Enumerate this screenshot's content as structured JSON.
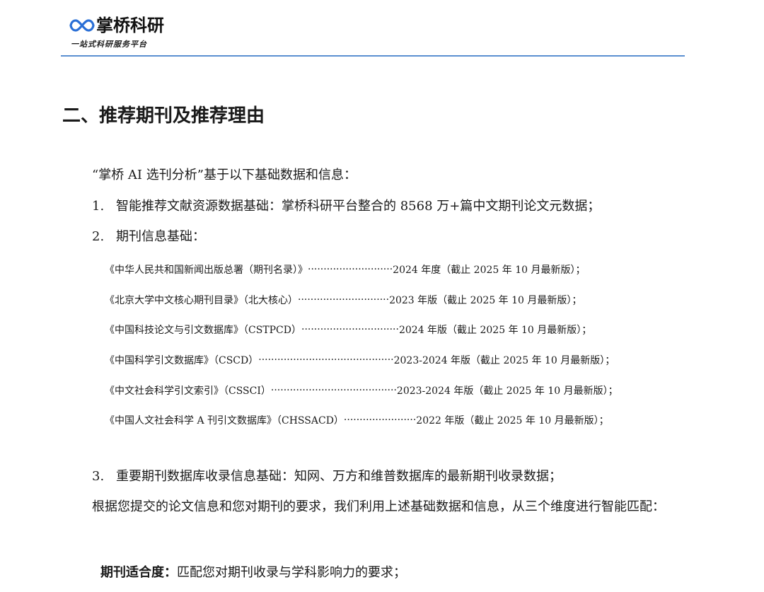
{
  "header": {
    "logo_text": "掌桥科研",
    "logo_subtitle": "一站式科研服务平台",
    "logo_icon": "infinity-icon",
    "accent_color": "#2a6fd6",
    "rule_color": "#5b8fd1"
  },
  "section": {
    "title": "二、推荐期刊及推荐理由"
  },
  "intro": "“掌桥 AI 选刊分析”基于以下基础数据和信息：",
  "items": [
    {
      "num": "1.",
      "text": "智能推荐文献资源数据基础：掌桥科研平台整合的 8568 万+篇中文期刊论文元数据；"
    },
    {
      "num": "2.",
      "text": "期刊信息基础："
    },
    {
      "num": "3.",
      "text": "重要期刊数据库收录信息基础：知网、万方和维普数据库的最新期刊收录数据；"
    }
  ],
  "sources": [
    {
      "name": "《中华人民共和国新闻出版总署（期刊名录）》",
      "dots": "···························",
      "edition": " 2024 年度（截止 2025 年 10 月最新版）；"
    },
    {
      "name": "《北京大学中文核心期刊目录》（北大核心）",
      "dots": "·····························",
      "edition": " 2023 年版（截止 2025 年 10 月最新版）；"
    },
    {
      "name": "《中国科技论文与引文数据库》（CSTPCD）",
      "dots": "·······························",
      "edition": " 2024 年版（截止 2025 年 10 月最新版）；"
    },
    {
      "name": "《中国科学引文数据库》（CSCD）",
      "dots": "···········································",
      "edition": " 2023-2024 年版（截止 2025 年 10 月最新版）；"
    },
    {
      "name": "《中文社会科学引文索引》（CSSCI）",
      "dots": "········································",
      "edition": "2023-2024 年版（截止 2025 年 10 月最新版）；"
    },
    {
      "name": "《中国人文社会科学 A 刊引文数据库》（CHSSACD）",
      "dots": "·······················",
      "edition": "2022 年版（截止 2025 年 10 月最新版）；"
    }
  ],
  "paragraph": "根据您提交的论文信息和您对期刊的要求，我们利用上述基础数据和信息，从三个维度进行智能匹配：",
  "criterion": {
    "label": "期刊适合度：",
    "text": "匹配您对期刊收录与学科影响力的要求；"
  }
}
